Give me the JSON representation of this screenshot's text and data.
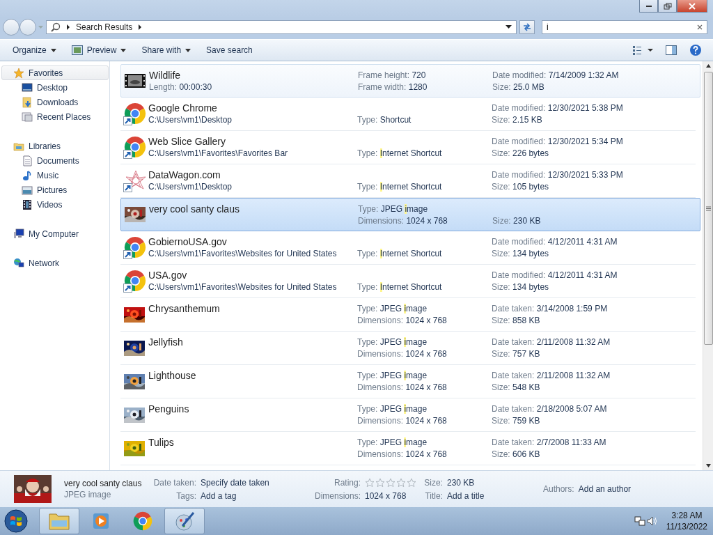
{
  "address": {
    "crumb": "Search Results"
  },
  "search": {
    "value": "i"
  },
  "toolbar": {
    "buttons": [
      {
        "label": "Organize",
        "dropdown": true
      },
      {
        "label": "Preview",
        "dropdown": true
      },
      {
        "label": "Share with",
        "dropdown": true
      },
      {
        "label": "Save search",
        "dropdown": false
      }
    ]
  },
  "sidebar": {
    "groups": [
      {
        "label": "Favorites",
        "selected": true,
        "children": [
          {
            "label": "Desktop",
            "selected": false
          },
          {
            "label": "Downloads",
            "selected": false
          },
          {
            "label": "Recent Places",
            "selected": false
          }
        ]
      },
      {
        "label": "Libraries",
        "selected": false,
        "children": [
          {
            "label": "Documents",
            "selected": false
          },
          {
            "label": "Music",
            "selected": false
          },
          {
            "label": "Pictures",
            "selected": false
          },
          {
            "label": "Videos",
            "selected": false
          }
        ]
      },
      {
        "label": "My Computer",
        "selected": false
      },
      {
        "label": "Network",
        "selected": false
      }
    ]
  },
  "results": [
    {
      "name": "Wildlife",
      "kind": "video",
      "selected": false,
      "hovered": true,
      "sub": {
        "label": "Length:",
        "parts": [
          {
            "text": "00:00:30"
          }
        ]
      },
      "mid_top": {
        "label": "Frame height:",
        "parts": [
          {
            "text": "720"
          }
        ]
      },
      "mid_bottom": {
        "label": "Frame width:",
        "parts": [
          {
            "text": "1280"
          }
        ]
      },
      "right_top": {
        "label": "Date modified:",
        "parts": [
          {
            "text": "7/14/2009 1:32 AM"
          }
        ]
      },
      "right_bottom": {
        "label": "Size:",
        "parts": [
          {
            "text": "25.0 MB"
          }
        ]
      }
    },
    {
      "name": "Google Chrome",
      "kind": "shortcut",
      "selected": false,
      "hovered": false,
      "sub": {
        "parts": [
          {
            "text": "C:\\Users\\vm1\\Desktop"
          }
        ]
      },
      "mid_bottom": {
        "label": "Type:",
        "parts": [
          {
            "text": "Shortcut"
          }
        ]
      },
      "right_top": {
        "label": "Date modified:",
        "parts": [
          {
            "text": "12/30/2021 5:38 PM"
          }
        ]
      },
      "right_bottom": {
        "label": "Size:",
        "parts": [
          {
            "text": "2.15 KB"
          }
        ]
      }
    },
    {
      "name": "Web Slice Gallery",
      "kind": "shortcut",
      "selected": false,
      "hovered": false,
      "sub": {
        "parts": [
          {
            "text": "C:\\Users\\vm1\\Favorites\\Favorites Bar"
          }
        ]
      },
      "mid_bottom": {
        "label": "Type:",
        "parts": [
          {
            "text": "I",
            "hit": true
          },
          {
            "text": "nternet Shortcut"
          }
        ]
      },
      "right_top": {
        "label": "Date modified:",
        "parts": [
          {
            "text": "12/30/2021 5:34 PM"
          }
        ]
      },
      "right_bottom": {
        "label": "Size:",
        "parts": [
          {
            "text": "226 bytes"
          }
        ]
      }
    },
    {
      "name": "DataWagon.com",
      "kind": "link",
      "selected": false,
      "hovered": false,
      "sub": {
        "parts": [
          {
            "text": "C:\\Users\\vm1\\Desktop"
          }
        ]
      },
      "mid_bottom": {
        "label": "Type:",
        "parts": [
          {
            "text": "I",
            "hit": true
          },
          {
            "text": "nternet Shortcut"
          }
        ]
      },
      "right_top": {
        "label": "Date modified:",
        "parts": [
          {
            "text": "12/30/2021 5:33 PM"
          }
        ]
      },
      "right_bottom": {
        "label": "Size:",
        "parts": [
          {
            "text": "105 bytes"
          }
        ]
      }
    },
    {
      "name": "very cool santy claus",
      "kind": "picture",
      "selected": true,
      "hovered": false,
      "mid_top": {
        "label": "Type:",
        "parts": [
          {
            "text": "JPEG "
          },
          {
            "text": "i",
            "hit": true
          },
          {
            "text": "mage"
          }
        ]
      },
      "mid_bottom": {
        "label": "Dimensions:",
        "parts": [
          {
            "text": "1024 x 768"
          }
        ]
      },
      "right_bottom": {
        "label": "Size:",
        "parts": [
          {
            "text": "230 KB"
          }
        ]
      }
    },
    {
      "name": "GobiernoUSA.gov",
      "kind": "shortcut",
      "selected": false,
      "hovered": false,
      "sub": {
        "parts": [
          {
            "text": "C:\\Users\\vm1\\Favorites\\Websites for United States"
          }
        ]
      },
      "mid_bottom": {
        "label": "Type:",
        "parts": [
          {
            "text": "I",
            "hit": true
          },
          {
            "text": "nternet Shortcut"
          }
        ]
      },
      "right_top": {
        "label": "Date modified:",
        "parts": [
          {
            "text": "4/12/2011 4:31 AM"
          }
        ]
      },
      "right_bottom": {
        "label": "Size:",
        "parts": [
          {
            "text": "134 bytes"
          }
        ]
      }
    },
    {
      "name": "USA.gov",
      "kind": "shortcut",
      "selected": false,
      "hovered": false,
      "sub": {
        "parts": [
          {
            "text": "C:\\Users\\vm1\\Favorites\\Websites for United States"
          }
        ]
      },
      "mid_bottom": {
        "label": "Type:",
        "parts": [
          {
            "text": "I",
            "hit": true
          },
          {
            "text": "nternet Shortcut"
          }
        ]
      },
      "right_top": {
        "label": "Date modified:",
        "parts": [
          {
            "text": "4/12/2011 4:31 AM"
          }
        ]
      },
      "right_bottom": {
        "label": "Size:",
        "parts": [
          {
            "text": "134 bytes"
          }
        ]
      }
    },
    {
      "name": "Chrysanthemum",
      "kind": "picture",
      "selected": false,
      "hovered": false,
      "mid_top": {
        "label": "Type:",
        "parts": [
          {
            "text": "JPEG "
          },
          {
            "text": "i",
            "hit": true
          },
          {
            "text": "mage"
          }
        ]
      },
      "mid_bottom": {
        "label": "Dimensions:",
        "parts": [
          {
            "text": "1024 x 768"
          }
        ]
      },
      "right_top": {
        "label": "Date taken:",
        "parts": [
          {
            "text": "3/14/2008 1:59 PM"
          }
        ]
      },
      "right_bottom": {
        "label": "Size:",
        "parts": [
          {
            "text": "858 KB"
          }
        ]
      }
    },
    {
      "name": "Jellyfish",
      "kind": "picture",
      "selected": false,
      "hovered": false,
      "mid_top": {
        "label": "Type:",
        "parts": [
          {
            "text": "JPEG "
          },
          {
            "text": "i",
            "hit": true
          },
          {
            "text": "mage"
          }
        ]
      },
      "mid_bottom": {
        "label": "Dimensions:",
        "parts": [
          {
            "text": "1024 x 768"
          }
        ]
      },
      "right_top": {
        "label": "Date taken:",
        "parts": [
          {
            "text": "2/11/2008 11:32 AM"
          }
        ]
      },
      "right_bottom": {
        "label": "Size:",
        "parts": [
          {
            "text": "757 KB"
          }
        ]
      }
    },
    {
      "name": "Lighthouse",
      "kind": "picture",
      "selected": false,
      "hovered": false,
      "mid_top": {
        "label": "Type:",
        "parts": [
          {
            "text": "JPEG "
          },
          {
            "text": "i",
            "hit": true
          },
          {
            "text": "mage"
          }
        ]
      },
      "mid_bottom": {
        "label": "Dimensions:",
        "parts": [
          {
            "text": "1024 x 768"
          }
        ]
      },
      "right_top": {
        "label": "Date taken:",
        "parts": [
          {
            "text": "2/11/2008 11:32 AM"
          }
        ]
      },
      "right_bottom": {
        "label": "Size:",
        "parts": [
          {
            "text": "548 KB"
          }
        ]
      }
    },
    {
      "name": "Penguins",
      "kind": "picture",
      "selected": false,
      "hovered": false,
      "mid_top": {
        "label": "Type:",
        "parts": [
          {
            "text": "JPEG "
          },
          {
            "text": "i",
            "hit": true
          },
          {
            "text": "mage"
          }
        ]
      },
      "mid_bottom": {
        "label": "Dimensions:",
        "parts": [
          {
            "text": "1024 x 768"
          }
        ]
      },
      "right_top": {
        "label": "Date taken:",
        "parts": [
          {
            "text": "2/18/2008 5:07 AM"
          }
        ]
      },
      "right_bottom": {
        "label": "Size:",
        "parts": [
          {
            "text": "759 KB"
          }
        ]
      }
    },
    {
      "name": "Tulips",
      "kind": "picture",
      "selected": false,
      "hovered": false,
      "mid_top": {
        "label": "Type:",
        "parts": [
          {
            "text": "JPEG "
          },
          {
            "text": "i",
            "hit": true
          },
          {
            "text": "mage"
          }
        ]
      },
      "mid_bottom": {
        "label": "Dimensions:",
        "parts": [
          {
            "text": "1024 x 768"
          }
        ]
      },
      "right_top": {
        "label": "Date taken:",
        "parts": [
          {
            "text": "2/7/2008 11:33 AM"
          }
        ]
      },
      "right_bottom": {
        "label": "Size:",
        "parts": [
          {
            "text": "606 KB"
          }
        ]
      }
    }
  ],
  "details": {
    "name": "very cool santy claus",
    "type": "JPEG image",
    "stars": 0,
    "fields": [
      {
        "label": "Date taken:",
        "value": "Specify date taken"
      },
      {
        "label": "Tags:",
        "value": "Add a tag"
      },
      {
        "label": "Rating:",
        "kind": "rating"
      },
      {
        "label": "Dimensions:",
        "value": "1024 x 768"
      },
      {
        "label": "Size:",
        "value": "230 KB"
      },
      {
        "label": "Title:",
        "value": "Add a title"
      },
      {
        "label": "Authors:",
        "value": "Add an author"
      }
    ]
  },
  "taskbar": {
    "apps": [
      {
        "kind": "explorer",
        "active": true
      },
      {
        "kind": "media",
        "active": false
      },
      {
        "kind": "chrome",
        "active": false
      },
      {
        "kind": "paint",
        "active": true
      }
    ],
    "time": "3:28 AM",
    "date": "11/13/2022"
  }
}
